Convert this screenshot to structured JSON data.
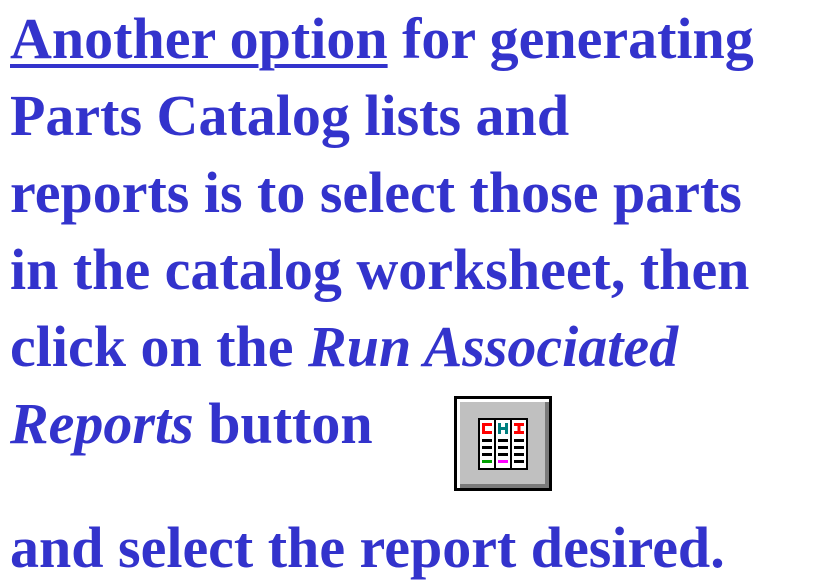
{
  "paragraph": {
    "line1_link": "Another option",
    "line1_rest": " for generating",
    "line2": "Parts Catalog lists and",
    "line3": "reports is to select those parts",
    "line4": "in the catalog worksheet, then",
    "line5_start": "click on the ",
    "line5_italic": "Run Associated",
    "line6_italic": "Reports",
    "line6_rest": " button",
    "line7": "and select the report desired."
  },
  "colors": {
    "text": "#3333cc",
    "background": "#ffffff",
    "button_face": "#c0c0c0"
  },
  "icons": {
    "run_associated_reports_button": "report-columns-icon"
  }
}
